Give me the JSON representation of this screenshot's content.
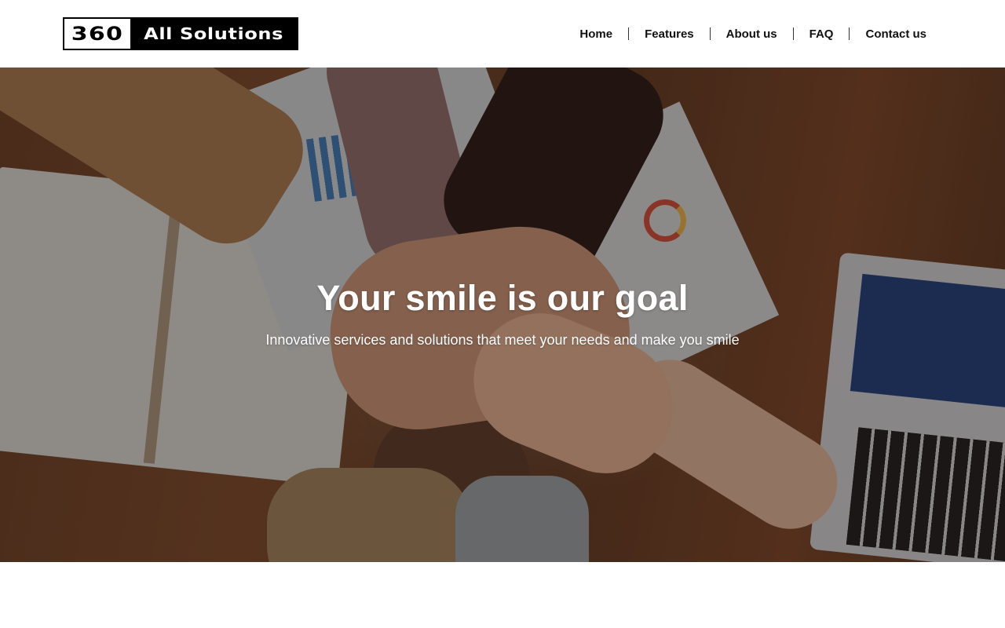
{
  "header": {
    "logo": {
      "number": "360",
      "name": "All Solutions"
    },
    "nav": {
      "items": [
        {
          "label": "Home"
        },
        {
          "label": "Features"
        },
        {
          "label": "About us"
        },
        {
          "label": "FAQ"
        },
        {
          "label": "Contact us"
        }
      ]
    }
  },
  "hero": {
    "title": "Your smile is our goal",
    "subtitle": "Innovative services and solutions that meet your needs and make you smile",
    "background_image": "team-hands-stacked-photo"
  },
  "colors": {
    "text_dark": "#111111",
    "hero_text": "#ffffff",
    "logo_black": "#000000"
  }
}
